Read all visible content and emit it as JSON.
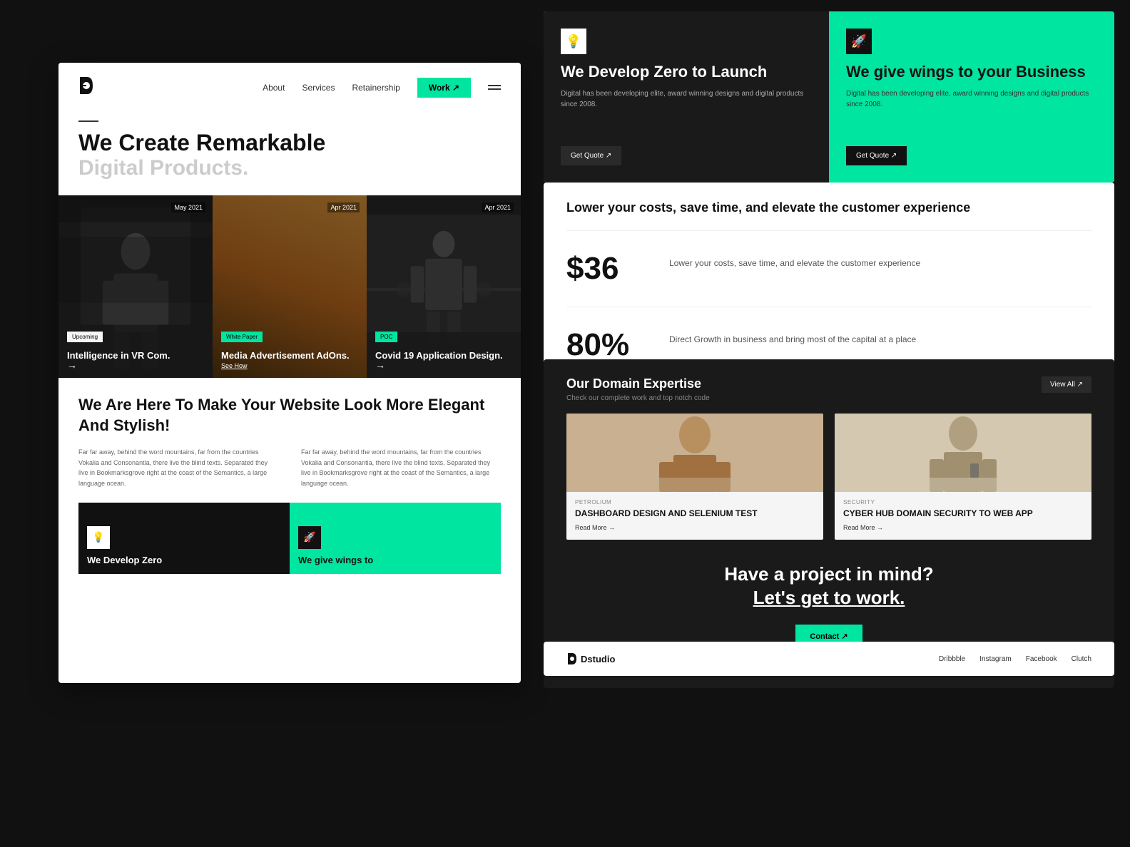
{
  "nav": {
    "logo": "D",
    "links": [
      "About",
      "Services",
      "Retainership"
    ],
    "work_btn": "Work ↗",
    "hamburger": "menu"
  },
  "hero": {
    "title": "We Create Remarkable",
    "subtitle": "Digital Products."
  },
  "portfolio": {
    "items": [
      {
        "date": "May 2021",
        "tag": "Upcoming",
        "tag_class": "upcoming",
        "title": "Intelligence in VR Com.",
        "arrow": "→"
      },
      {
        "date": "Apr  2021",
        "tag": "White Paper",
        "tag_class": "whitepaper",
        "title": "Media Advertisement AdOns.",
        "link": "See How"
      },
      {
        "date": "Apr  2021",
        "tag": "POC",
        "tag_class": "poc",
        "title": "Covid 19 Application Design.",
        "arrow": "→"
      }
    ]
  },
  "bottom_section": {
    "headline": "We Are Here To Make Your Website Look More Elegant And Stylish!",
    "col1": "Far far away, behind the word mountains, far from the countries Vokalia and Consonantia, there live the blind texts. Separated they live in Bookmarksgrove right at the coast of the Semantics, a large language ocean.",
    "col2": "Far far away, behind the word mountains, far from the countries Vokalia and Consonantia, there live the blind texts. Separated they live in Bookmarksgrove right at the coast of the Semantics, a large language ocean.",
    "card1_label": "We Develop Zero",
    "card2_label": "We give wings to"
  },
  "cards": {
    "card1": {
      "icon": "💡",
      "title": "We Develop Zero to Launch",
      "desc": "Digital has been developing elite, award winning designs and digital products  since 2008.",
      "btn": "Get Quote ↗"
    },
    "card2": {
      "icon": "🚀",
      "title": "We give wings to your Business",
      "desc": "Digital has been developing elite, award winning designs and digital products  since 2008.",
      "btn": "Get Quote ↗"
    }
  },
  "stats": {
    "headline": "Lower your costs, save time,\nand elevate the customer experience",
    "items": [
      {
        "number": "$36",
        "desc": "Lower your costs, save time,\nand elevate the customer experience"
      },
      {
        "number": "80%",
        "desc": "Direct Growth in business and\nbring most of the capital at a place"
      }
    ]
  },
  "domain": {
    "title": "Our Domain Expertise",
    "subtitle": "Check our complete work and top notch code",
    "view_all": "View All ↗",
    "items": [
      {
        "tag": "PETROLIUM",
        "title": "DASHBOARD DESIGN AND SELENIUM TEST",
        "read_more": "Read More →"
      },
      {
        "tag": "SECURITY",
        "title": "CYBER HUB DOMAIN SECURITY TO WEB APP",
        "read_more": "Read More →"
      }
    ]
  },
  "cta": {
    "line1": "Have a project in mind?",
    "line2_pre": "Let's get to ",
    "line2_link": "work.",
    "btn": "Contact ↗"
  },
  "footer": {
    "logo": "Dstudio",
    "links": [
      "Dribbble",
      "Instagram",
      "Facebook",
      "Clutch"
    ]
  }
}
